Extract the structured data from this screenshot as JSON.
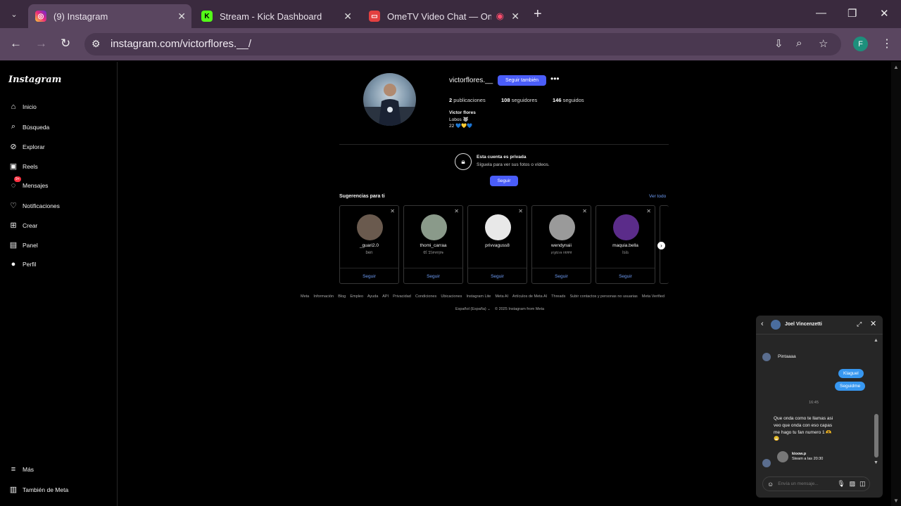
{
  "browser": {
    "tabs": [
      {
        "title": "(9) Instagram",
        "favicon": "instagram-icon",
        "active": true
      },
      {
        "title": "Stream - Kick Dashboard",
        "favicon": "kick-icon",
        "active": false
      },
      {
        "title": "OmeTV Video Chat — Ome",
        "favicon": "ometv-icon",
        "active": false
      }
    ],
    "url": "instagram.com/victorflores.__/",
    "profile_initial": "F"
  },
  "sidebar": {
    "logo": "Instagram",
    "items": [
      {
        "label": "Inicio",
        "icon": "home-icon"
      },
      {
        "label": "Búsqueda",
        "icon": "search-icon"
      },
      {
        "label": "Explorar",
        "icon": "compass-icon"
      },
      {
        "label": "Reels",
        "icon": "reels-icon"
      },
      {
        "label": "Mensajes",
        "icon": "messenger-icon",
        "badge": "9+"
      },
      {
        "label": "Notificaciones",
        "icon": "heart-icon"
      },
      {
        "label": "Crear",
        "icon": "plus-square-icon"
      },
      {
        "label": "Panel",
        "icon": "dashboard-icon"
      },
      {
        "label": "Perfil",
        "icon": "avatar-icon"
      }
    ],
    "bottom": [
      {
        "label": "Más",
        "icon": "menu-icon"
      },
      {
        "label": "También de Meta",
        "icon": "meta-icon"
      }
    ]
  },
  "profile": {
    "username": "victorflores.__",
    "follow_back_label": "Seguir también",
    "posts": "2",
    "posts_label": "publicaciones",
    "followers": "108",
    "followers_label": "seguidores",
    "following": "146",
    "following_label": "seguidos",
    "name": "Victor flores",
    "bio1": "Lobos 🐺",
    "bio2": "22 💙💛💙",
    "private_title": "Esta cuenta es privada",
    "private_sub": "Síguela para ver sus fotos o vídeos.",
    "follow_label": "Seguir"
  },
  "suggestions": {
    "title": "Sugerencias para ti",
    "see_all": "Ver todo",
    "cards": [
      {
        "name": "_guari2.0",
        "sub": "ben",
        "btn": "Seguir",
        "color": "#6a5a4e"
      },
      {
        "name": "thomi_carraa",
        "sub": "𝔈𝔩 𝔗𝔥𝔬𝔪𝔦𝔧𝔬𝔰",
        "btn": "Seguir",
        "color": "#8a9a8a"
      },
      {
        "name": "privvaguss8",
        "sub": "",
        "btn": "Seguir",
        "color": "#e8e8e8"
      },
      {
        "name": "wendynaii",
        "sub": "𝔭𝔦𝔷𝔞𝔯𝔢𝔰 𝔪𝔬𝔬𝔫",
        "btn": "Seguir",
        "color": "#9a9a9a"
      },
      {
        "name": "maquia.bella",
        "sub": "Isis",
        "btn": "Seguir",
        "color": "#5b2c8a"
      }
    ]
  },
  "footer": {
    "links": [
      "Meta",
      "Información",
      "Blog",
      "Empleo",
      "Ayuda",
      "API",
      "Privacidad",
      "Condiciones",
      "Ubicaciones",
      "Instagram Lite",
      "Meta AI",
      "Artículos de Meta AI",
      "Threads",
      "Subir contactos y personas no usuarias",
      "Meta Verified"
    ],
    "language": "Español (España)",
    "copyright": "© 2025 Instagram from Meta"
  },
  "chat": {
    "name": "Joel Vincenzetti",
    "msg_in1": "Pintaaaa",
    "msg_out1": "Klaguel",
    "msg_out2": "Seguidme",
    "time": "16:45",
    "msg_in2": "Que onda como te llamas asi veo que onda con eso capas me hago tu fan numero 1 🫶😁",
    "reel_user": "kioow.p",
    "reel_sub": "Steam a las 20:30",
    "placeholder": "Envía un mensaje..."
  },
  "colors": {
    "accent": "#4a5df9",
    "link": "#6e9cf5",
    "chat_bubble": "#3797f0"
  }
}
